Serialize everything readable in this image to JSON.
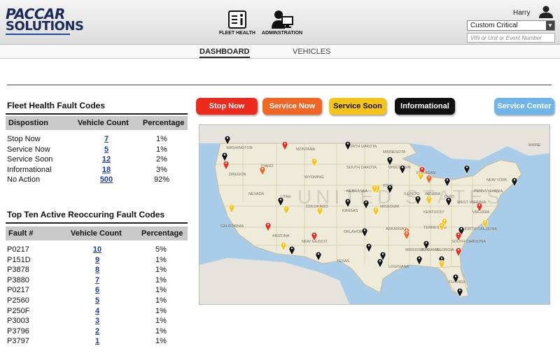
{
  "header": {
    "logo_line1": "PACCAR",
    "logo_line2": "SOLUTIONS",
    "nav": [
      {
        "label": "FLEET HEALTH",
        "icon": "fleet-health-icon"
      },
      {
        "label": "ADMINSTRATION",
        "icon": "administration-icon"
      }
    ],
    "user_name": "Harry",
    "filter_selected": "Custom Critical",
    "search_placeholder": "VIN or Unit or Event Number"
  },
  "tabs": [
    {
      "label": "DASHBOARD",
      "active": true
    },
    {
      "label": "VEHICLES",
      "active": false
    }
  ],
  "fleet_health": {
    "title": "Fleet Health Fault Codes",
    "columns": [
      "Dispostion",
      "Vehicle Count",
      "Percentage"
    ],
    "rows": [
      {
        "label": "Stop Now",
        "count": "7",
        "pct": "1%"
      },
      {
        "label": "Service Now",
        "count": "5",
        "pct": "1%"
      },
      {
        "label": "Service Soon",
        "count": "12",
        "pct": "2%"
      },
      {
        "label": "Informational",
        "count": "18",
        "pct": "3%"
      },
      {
        "label": "No Action",
        "count": "500",
        "pct": "92%"
      }
    ]
  },
  "top_ten": {
    "title": "Top Ten Active Reoccuring Fault Codes",
    "columns": [
      "Fault #",
      "Vehicle Count",
      "Percentage"
    ],
    "rows": [
      {
        "fault": "P0217",
        "count": "10",
        "pct": "5%"
      },
      {
        "fault": "P151D",
        "count": "9",
        "pct": "1%"
      },
      {
        "fault": "P3878",
        "count": "8",
        "pct": "1%"
      },
      {
        "fault": "P3880",
        "count": "7",
        "pct": "1%"
      },
      {
        "fault": "P0217",
        "count": "6",
        "pct": "1%"
      },
      {
        "fault": "P2560",
        "count": "5",
        "pct": "1%"
      },
      {
        "fault": "P250F",
        "count": "4",
        "pct": "1%"
      },
      {
        "fault": "P3003",
        "count": "3",
        "pct": "1%"
      },
      {
        "fault": "P3796",
        "count": "2",
        "pct": "1%"
      },
      {
        "fault": "P3797",
        "count": "1",
        "pct": "1%"
      }
    ]
  },
  "legend": [
    {
      "label": "Stop Now",
      "bg": "#ee2a1c",
      "fg": "#ffffff",
      "name": "stop-now"
    },
    {
      "label": "Service Now",
      "bg": "#f26522",
      "fg": "#ffffff",
      "name": "service-now"
    },
    {
      "label": "Service Soon",
      "bg": "#f7c417",
      "fg": "#111111",
      "name": "service-soon"
    },
    {
      "label": "Informational",
      "bg": "#111111",
      "fg": "#ffffff",
      "name": "informational"
    },
    {
      "label": "Service Center",
      "bg": "#6fb5ea",
      "fg": "#ffffff",
      "name": "service-center"
    }
  ],
  "map": {
    "watermark": "UNITED STATES",
    "states": [
      "WASHINGTON",
      "MONTANA",
      "NORTH DAKOTA",
      "MINNESOTA",
      "OREGON",
      "IDAHO",
      "SOUTH DAKOTA",
      "WYOMING",
      "IOWA",
      "NEBRASKA",
      "NEVADA",
      "UTAH",
      "COLORADO",
      "KANSAS",
      "MISSOURI",
      "CALIFORNIA",
      "ARIZONA",
      "NEW MEXICO",
      "OKLAHOMA",
      "TEXAS",
      "TENNESSEE",
      "ARKANSAS",
      "GEORGIA",
      "NORTH CAROLINA",
      "ALABAMA",
      "FLORIDA",
      "KENTUCKY",
      "PENNSYLVANIA",
      "NEW YORK",
      "MICHIGAN",
      "VIRGINIA",
      "OHIO",
      "INDIANA",
      "ILLINOIS",
      "WISCONSIN",
      "MISSISSIPPI",
      "LOUISIANA",
      "SOUTH CAROLINA",
      "WEST VIRGINIA",
      "MAINE"
    ],
    "pins": [
      {
        "status": "informational"
      },
      {
        "status": "stop-now"
      },
      {
        "status": "informational"
      },
      {
        "status": "informational"
      },
      {
        "status": "stop-now"
      },
      {
        "status": "service-soon"
      },
      {
        "status": "service-now"
      },
      {
        "status": "informational"
      },
      {
        "status": "informational"
      },
      {
        "status": "stop-now"
      },
      {
        "status": "service-soon"
      },
      {
        "status": "informational"
      },
      {
        "status": "informational"
      },
      {
        "status": "informational"
      },
      {
        "status": "service-soon"
      },
      {
        "status": "informational"
      },
      {
        "status": "service-soon"
      },
      {
        "status": "service-now"
      },
      {
        "status": "service-soon"
      },
      {
        "status": "informational"
      },
      {
        "status": "informational"
      },
      {
        "status": "informational"
      },
      {
        "status": "informational"
      },
      {
        "status": "service-soon"
      },
      {
        "status": "service-soon"
      },
      {
        "status": "service-soon"
      },
      {
        "status": "service-soon"
      },
      {
        "status": "informational"
      },
      {
        "status": "service-now"
      },
      {
        "status": "stop-now"
      },
      {
        "status": "service-soon"
      },
      {
        "status": "stop-now"
      },
      {
        "status": "service-soon"
      },
      {
        "status": "informational"
      },
      {
        "status": "service-soon"
      },
      {
        "status": "informational"
      },
      {
        "status": "service-now"
      },
      {
        "status": "service-soon"
      },
      {
        "status": "informational"
      },
      {
        "status": "stop-now"
      },
      {
        "status": "informational"
      },
      {
        "status": "informational"
      },
      {
        "status": "informational"
      },
      {
        "status": "stop-now"
      },
      {
        "status": "informational"
      },
      {
        "status": "informational"
      },
      {
        "status": "informational"
      },
      {
        "status": "stop-now"
      },
      {
        "status": "service-soon"
      },
      {
        "status": "informational"
      },
      {
        "status": "informational"
      },
      {
        "status": "informational"
      }
    ]
  }
}
